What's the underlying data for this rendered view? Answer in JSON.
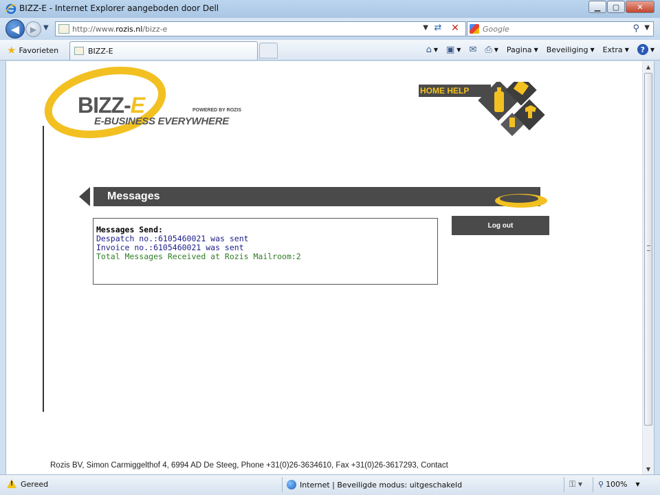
{
  "window": {
    "title": "BIZZ-E - Internet Explorer aangeboden door Dell",
    "minimize": "▁",
    "maximize": "▢",
    "close": "✕"
  },
  "navigation": {
    "url_prefix": "http://www.",
    "url_domain": "rozis.nl",
    "url_path": "/bizz-e",
    "search_placeholder": "Google"
  },
  "favorites_bar": {
    "favorites_label": "Favorieten",
    "tab_title": "BIZZ-E"
  },
  "command_bar": {
    "page_label": "Pagina",
    "security_label": "Beveiliging",
    "extra_label": "Extra",
    "help_label": "?"
  },
  "page": {
    "logo": {
      "brand_main": "BIZZ-",
      "brand_e": "E",
      "powered_by": "POWERED BY ROZIS",
      "tagline": "E-BUSINESS EVERYWHERE"
    },
    "home_help": "HOME HELP",
    "section_title": "Messages",
    "messages": {
      "heading": "Messages Send:",
      "line1": "Despatch no.:6105460021 was sent",
      "line2": "Invoice no.:6105460021 was sent",
      "line3": "Total Messages Received at Rozis Mailroom:2"
    },
    "logout_label": "Log out",
    "footer": "Rozis BV, Simon Carmiggelthof 4, 6994 AD De Steeg, Phone +31(0)26-3634610, Fax +31(0)26-3617293, Contact"
  },
  "status_bar": {
    "status": "Gereed",
    "zone": "Internet | Beveiligde modus: uitgeschakeld",
    "zoom": "100%"
  },
  "colors": {
    "brand_yellow": "#f2c021",
    "dark_gray": "#4a4a4a",
    "message_blue": "#1c1c8a",
    "message_green": "#2e7d24"
  }
}
